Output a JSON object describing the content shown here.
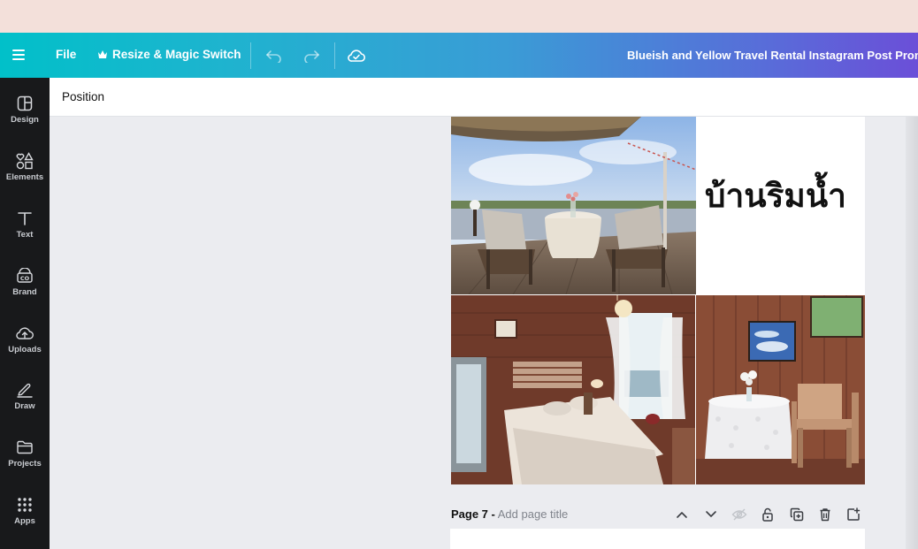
{
  "header": {
    "menu_icon": "hamburger-menu-icon",
    "file_label": "File",
    "resize_label": "Resize & Magic Switch",
    "undo_icon": "undo-icon",
    "redo_icon": "redo-icon",
    "save_status_icon": "cloud-check-icon",
    "document_title": "Blueish and Yellow Travel Rental Instagram Post Promo"
  },
  "sidebar": {
    "items": [
      {
        "label": "Design",
        "icon": "design-icon"
      },
      {
        "label": "Elements",
        "icon": "elements-icon"
      },
      {
        "label": "Text",
        "icon": "text-icon"
      },
      {
        "label": "Brand",
        "icon": "brand-icon"
      },
      {
        "label": "Uploads",
        "icon": "uploads-icon"
      },
      {
        "label": "Draw",
        "icon": "draw-icon"
      },
      {
        "label": "Projects",
        "icon": "projects-icon"
      },
      {
        "label": "Apps",
        "icon": "apps-icon"
      }
    ]
  },
  "toolbar": {
    "position_label": "Position"
  },
  "canvas": {
    "caption": "บ้านริมน้ำ",
    "photos": [
      "river-deck-photo",
      "bedroom-photo",
      "dining-corner-photo"
    ]
  },
  "page_footer": {
    "page_number": "Page 7 -",
    "add_title_placeholder": "Add page title",
    "tools": [
      "chevron-up-icon",
      "chevron-down-icon",
      "hide-icon",
      "lock-icon",
      "duplicate-icon",
      "delete-icon",
      "add-page-icon"
    ]
  },
  "colors": {
    "accent_start": "#01c0c9",
    "accent_end": "#6b4fd8",
    "sidebar_bg": "#18191b"
  }
}
